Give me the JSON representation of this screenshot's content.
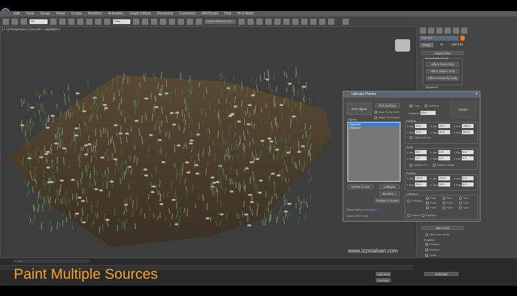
{
  "menu": [
    "Edit",
    "Tools",
    "Group",
    "Views",
    "Create",
    "Modifiers",
    "Animation",
    "Graph Editors",
    "Rendering",
    "Customize",
    "MAXScript",
    "Help",
    "Hi-O-Matic"
  ],
  "toolbar": {
    "selection_filter": "All",
    "ref_coord": "View",
    "named_selection": "Create Selection Set"
  },
  "viewport": {
    "label": "[ + ] [ Perspective ] [ Smooth + Highlights ]"
  },
  "command_panel": {
    "object_name": "Object04",
    "tabs": [
      "Pivot",
      "IK",
      "Link Info"
    ],
    "rollout_adjust": "Adjust Pivot",
    "group_move": "Move/Rotate/Scale:",
    "buttons": [
      "Affect Pivot Only",
      "Affect Object Only",
      "Affect Hierarchy Only"
    ],
    "alignment": "Alignment:",
    "rollout_skin": "Skin Pose",
    "skin_pose_mode": "Skin Pose Mode",
    "enabled": "Enabled:",
    "skin_checks": [
      "Position",
      "Rotation",
      "Scale"
    ],
    "accent": "#e87b1e"
  },
  "dialog": {
    "title": "Ultimate Painter",
    "pick_object": "Pick Object",
    "pick_surface": "Pick Surface",
    "align_normals": "Align To Normals",
    "attach_surface": "Attach To Surface",
    "objects_label": "Objects",
    "objects": [
      "Object03",
      "Object04"
    ],
    "delete_list": "Delete in List",
    "collapse": "Collapse",
    "boolean": "Boolean +",
    "delete_scene": "Delete in Scene",
    "maxscript_by": "Maxscript by",
    "author": "Izzet Altinel",
    "credit": "Gizmo GR? 2012",
    "instance_copy": "Copy",
    "instance": "Instance",
    "distance_label": "Distance",
    "distance": "50.0",
    "paint": "PAINT",
    "rotation": {
      "label": "Rotation",
      "fields": [
        [
          "X Min",
          "10.0"
        ],
        [
          "Y Min",
          "10.0"
        ],
        [
          "Z Min",
          "-180.0"
        ],
        [
          "X Max",
          "10.0"
        ],
        [
          "Y Max",
          "10.0"
        ],
        [
          "Z Max",
          "180.0"
        ]
      ],
      "follow_mouse": "Follow Mouse"
    },
    "scale": {
      "label": "Scale",
      "fields": [
        [
          "X Min",
          "0.8"
        ],
        [
          "Y Min",
          "0.8"
        ],
        [
          "Z Min",
          "0.8"
        ],
        [
          "X Max",
          "1.2"
        ],
        [
          "Y Max",
          "1.2"
        ],
        [
          "Z Max",
          "1.2"
        ]
      ],
      "uniform_xy": "Uniform XY",
      "uniform": "Uniform Scale"
    },
    "position": {
      "label": "Position",
      "fields": [
        [
          "X Min",
          "-20.0"
        ],
        [
          "Y Min",
          "-20.0"
        ],
        [
          "Z Min",
          "0.0"
        ],
        [
          "X Max",
          "20.0"
        ],
        [
          "Y Max",
          "20.0"
        ],
        [
          "Z Max",
          "0.0"
        ]
      ]
    },
    "collisions": {
      "label": "Collisions",
      "collision": "Collision",
      "checks": [
        "Pos1",
        "Pos2",
        "Pos3",
        "Rot1",
        "Rot2",
        "Rot3",
        "Scl1",
        "Scl2",
        "Scl3"
      ],
      "source": "Source",
      "replace": "Replace"
    }
  },
  "watermark": "www.izzetalsan.com",
  "caption": "Paint Multiple Sources",
  "timeline": {
    "frame": "0 / 100",
    "key_mode": "Selected",
    "auto_key": "Auto Key",
    "set_key": "Set Key"
  }
}
